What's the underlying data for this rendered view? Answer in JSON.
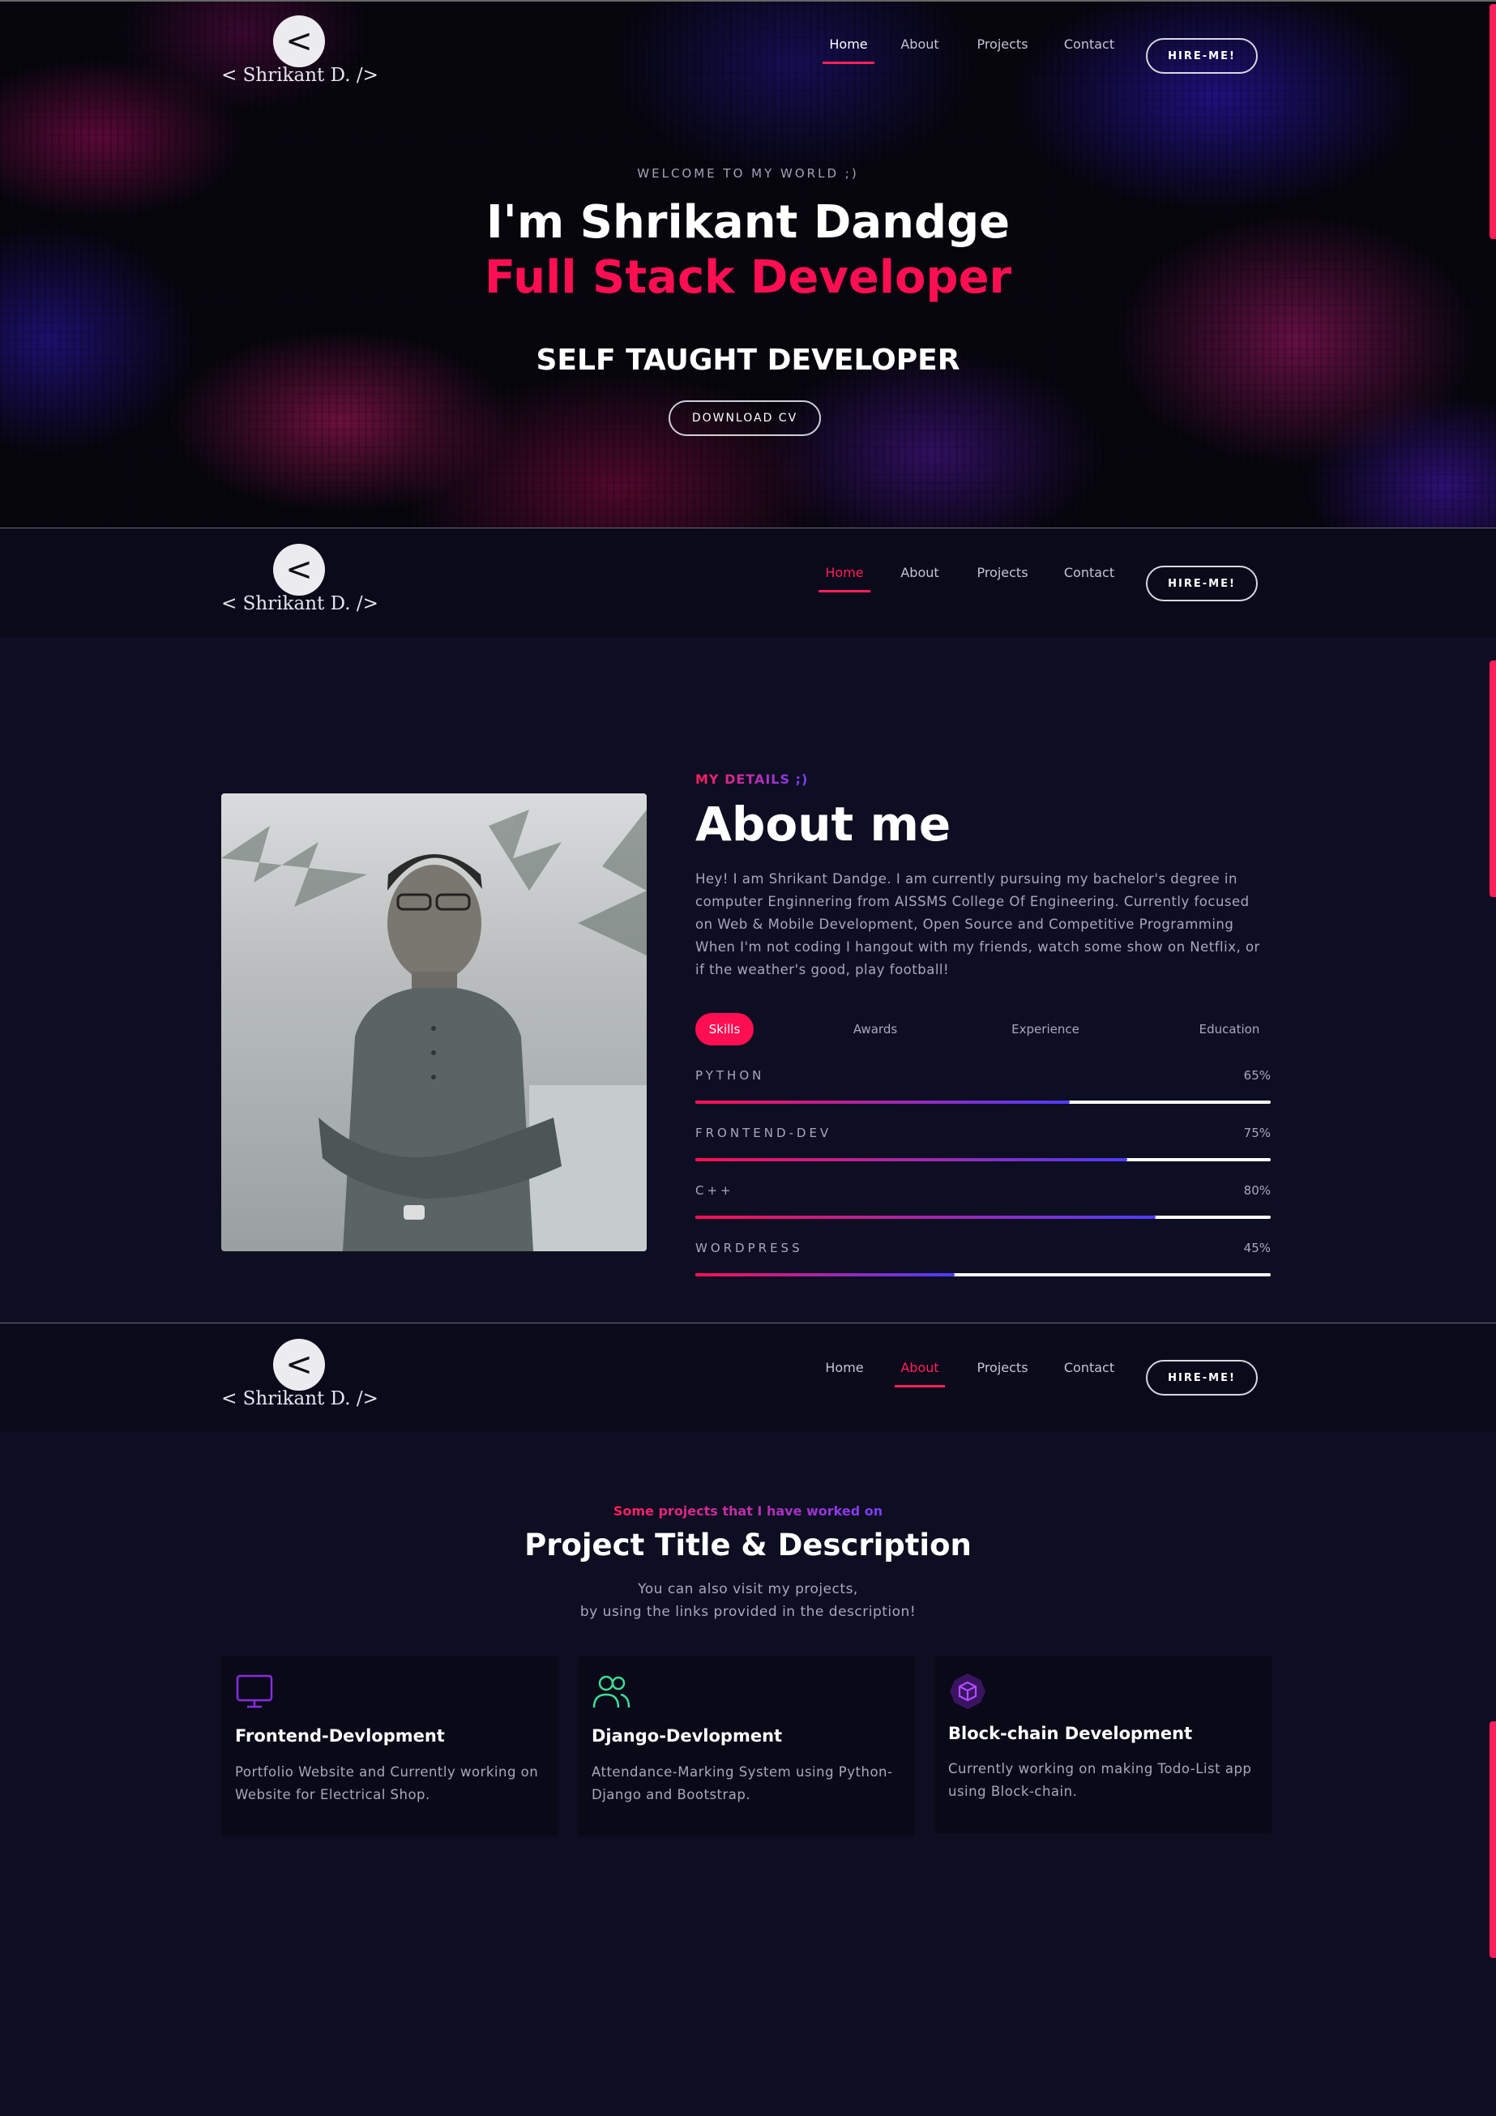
{
  "brand": {
    "logo_glyph": "<",
    "logo_text": "< Shrikant D. />"
  },
  "nav": {
    "links": [
      "Home",
      "About",
      "Projects",
      "Contact"
    ],
    "hire_label": "HIRE-ME!",
    "accent_color": "#ff1f5a"
  },
  "hero": {
    "welcome": "WELCOME TO MY WORLD ;)",
    "name": "I'm Shrikant Dandge",
    "role": "Full Stack Developer",
    "tagline": "SELF TAUGHT DEVELOPER",
    "cv_button": "DOWNLOAD CV"
  },
  "about": {
    "label": "MY DETAILS ;)",
    "title": "About me",
    "text": "Hey! I am Shrikant Dandge. I am currently pursuing my bachelor's degree in computer Enginnering from AISSMS College Of Engineering. Currently focused on Web & Mobile Development, Open Source and Competitive Programming When I'm not coding I hangout with my friends, watch some show on Netflix, or if the weather's good, play football!",
    "tabs": [
      "Skills",
      "Awards",
      "Experience",
      "Education"
    ],
    "skills": [
      {
        "name": "PYTHON",
        "percent": "65%",
        "value": 65
      },
      {
        "name": "FRONTEND-DEV",
        "percent": "75%",
        "value": 75
      },
      {
        "name": "C++",
        "percent": "80%",
        "value": 80
      },
      {
        "name": "WORDPRESS",
        "percent": "45%",
        "value": 45
      }
    ]
  },
  "projects": {
    "label": "Some projects that I have worked on",
    "title": "Project Title & Description",
    "subtitle_line1": "You can also visit my projects,",
    "subtitle_line2": "by using the links provided in the description!",
    "cards": [
      {
        "icon": "monitor-icon",
        "title": "Frontend-Devlopment",
        "text": "Portfolio Website and Currently working on Website for Electrical Shop."
      },
      {
        "icon": "users-icon",
        "title": "Django-Devlopment",
        "text": "Attendance-Marking System using Python-Django and Bootstrap."
      },
      {
        "icon": "cube-icon",
        "title": "Block-chain Development",
        "text": "Currently working on making Todo-List app using Block-chain."
      }
    ]
  }
}
